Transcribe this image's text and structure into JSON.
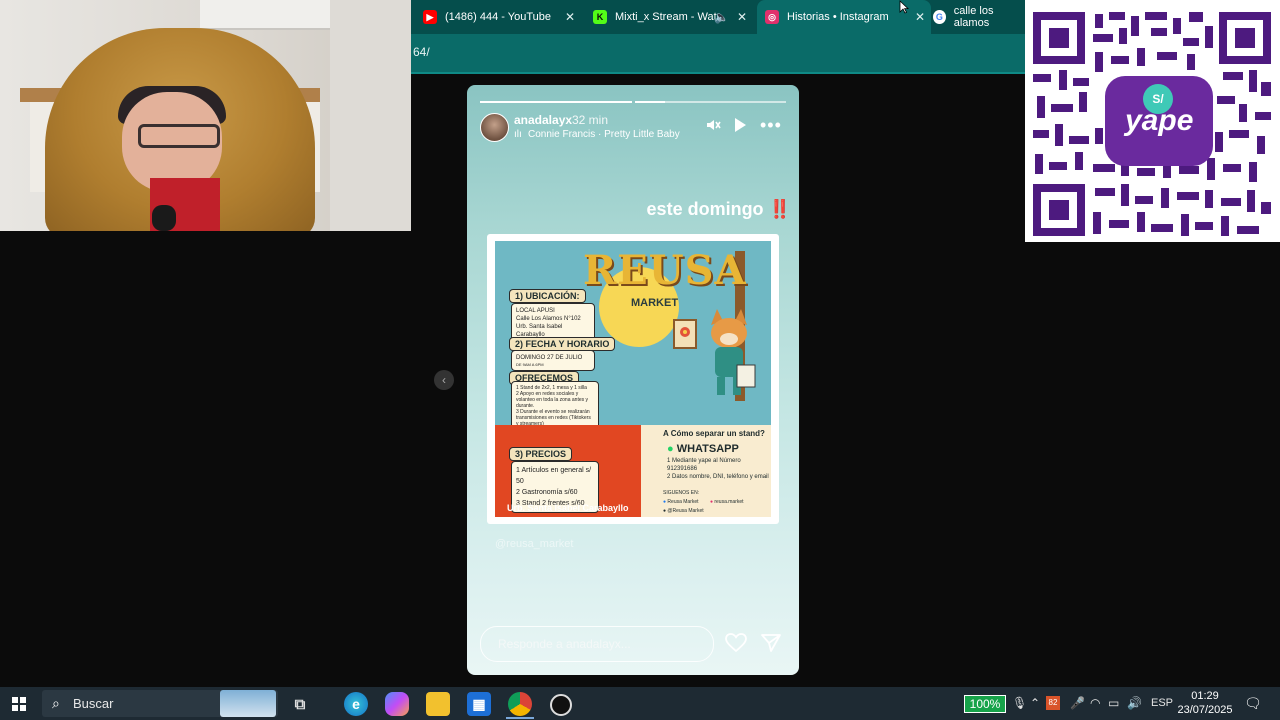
{
  "browser": {
    "tabs": [
      {
        "title": "(1486) 444 - YouTube",
        "icon": "youtube-icon",
        "color": "#ff0000"
      },
      {
        "title": "Mixti_x Stream - Watc",
        "icon": "kick-icon",
        "color": "#53fc18"
      },
      {
        "title": "Historias • Instagram",
        "icon": "instagram-icon",
        "color": "#e1306c"
      },
      {
        "title": "calle los alamos",
        "icon": "google-icon",
        "color": "#4285f4"
      }
    ],
    "url_fragment": "64/"
  },
  "story": {
    "username": "anadalayx",
    "time_ago": "32 min",
    "song": "Connie Francis · Pretty Little Baby",
    "caption": "este domingo",
    "caption_emoji": "‼️",
    "watermark": "@reusa_market",
    "reply_placeholder": "Responde a anadalayx..."
  },
  "poster": {
    "title": "REUSA",
    "subtitle": "MARKET",
    "sections": [
      {
        "heading": "1) UBICACIÓN:",
        "lines": [
          "LOCAL APUSI",
          "Calle Los Alamos N°102",
          "Urb. Santa Isabel Carabayllo"
        ]
      },
      {
        "heading": "2) FECHA Y HORARIO",
        "lines": [
          "DOMINGO 27 DE JULIO",
          "DE 9AM A 6PM"
        ]
      },
      {
        "heading": "OFRECEMOS",
        "lines": [
          "1 Stand de 2x2, 1 mesa y 1 silla",
          "2 Apoyo en redes sociales y volanteo en toda la zona antes y durante.",
          "3 Durante el evento se realizarán transmisiones en redes (Tiktokers y streamers)"
        ]
      },
      {
        "heading": "3) PRECIOS",
        "lines": [
          "1 Artículos en general s/ 50",
          "2 Gastronomía s/60",
          "3 Stand 2 frentes s/60"
        ]
      }
    ],
    "stand_question": "A Cómo separar un stand?",
    "whatsapp": "WHATSAPP",
    "whatsapp_lines": [
      "1 Mediante yape al Número 912391686",
      "2 Datos nombre, DNI, teléfono y email"
    ],
    "social_heading": "SIGUENOS EN:",
    "social": [
      "Reusa Market",
      "reusa.market",
      "@Reusa Market"
    ],
    "footer": "Urb. Santa Isabel Carabayllo"
  },
  "qr": {
    "brand": "yape",
    "badge": "S/"
  },
  "taskbar": {
    "search_label": "Buscar",
    "battery": "100%",
    "language": "ESP",
    "time": "01:29",
    "date": "23/07/2025",
    "tray_badge": "82"
  }
}
